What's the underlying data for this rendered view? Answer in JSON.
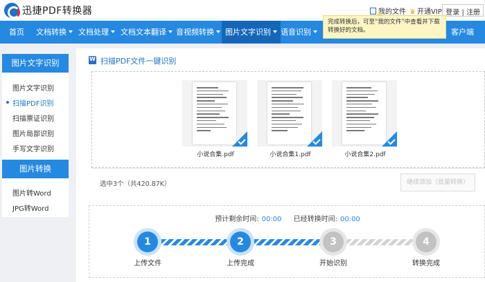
{
  "app": {
    "title": "迅捷PDF转换器"
  },
  "topbar": {
    "my_files": "我的文件",
    "vip": "开通VIP",
    "login": "登录",
    "separator": "|",
    "register": "注册"
  },
  "tooltip": {
    "text": "完成转换后，可至“我的文件”中查看并下载转换好的文档。"
  },
  "nav": {
    "items": [
      {
        "label": "首页"
      },
      {
        "label": "文档转换"
      },
      {
        "label": "文档处理"
      },
      {
        "label": "文档文本翻译"
      },
      {
        "label": "音视频转换"
      },
      {
        "label": "图片文字识别"
      },
      {
        "label": "语音识别"
      },
      {
        "label": "客户端"
      }
    ]
  },
  "sidebar": {
    "group1_title": "图片文字识别",
    "group1_items": [
      {
        "label": "图片文字识别"
      },
      {
        "label": "扫描PDF识别"
      },
      {
        "label": "扫描票证识别"
      },
      {
        "label": "图片局部识别"
      },
      {
        "label": "手写文字识别"
      }
    ],
    "group2_title": "图片转换",
    "group2_items": [
      {
        "label": "图片转Word"
      },
      {
        "label": "JPG转Word"
      }
    ]
  },
  "main": {
    "section_title": "扫描PDF文件一键识别",
    "files": [
      {
        "name": "小说合集.pdf"
      },
      {
        "name": "小说合集1.pdf"
      },
      {
        "name": "小说合集2.pdf"
      }
    ],
    "summary": "选中3个（共420.87K）",
    "continue_button": "继续添加（批量转换）",
    "remaining_label": "预计剩余时间:",
    "remaining_value": "00:00",
    "elapsed_label": "已经转换时间:",
    "elapsed_value": "00:00",
    "steps": [
      {
        "number": "1",
        "label": "上传文件",
        "state": "done"
      },
      {
        "number": "2",
        "label": "上传完成",
        "state": "done"
      },
      {
        "number": "3",
        "label": "开始识别",
        "state": "pending"
      },
      {
        "number": "4",
        "label": "转换完成",
        "state": "pending"
      }
    ]
  },
  "colors": {
    "primary": "#2589e1",
    "nav_active": "#1467b8",
    "pending": "#c2c2c2"
  }
}
